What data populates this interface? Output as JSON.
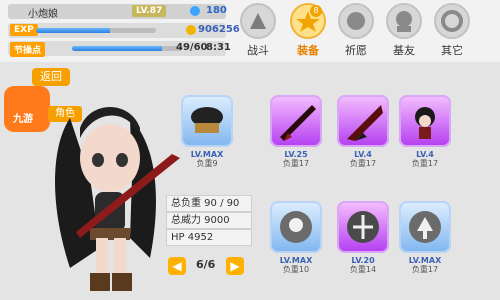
{
  "player": {
    "name": "小炮娘",
    "level": "LV.87",
    "gems": "180",
    "exp_label": "EXP",
    "gold": "906256",
    "stamina_label": "节操点",
    "stamina": "49/60",
    "timer": "8:31",
    "exp_progress": 0.62,
    "stamina_progress": 0.82
  },
  "tabs": [
    {
      "label": "战斗",
      "active": false
    },
    {
      "label": "装备",
      "active": true,
      "badge": "8"
    },
    {
      "label": "祈愿",
      "active": false
    },
    {
      "label": "基友",
      "active": false
    },
    {
      "label": "其它",
      "active": false
    }
  ],
  "back_label": "返回",
  "watermark_text": "九游",
  "watermark_small": "角色",
  "top_slots": [
    {
      "level": "LV.MAX",
      "weight": "负重9",
      "style": "blue"
    },
    {
      "level": "LV.25",
      "weight": "负重17",
      "style": "purple"
    },
    {
      "level": "LV.4",
      "weight": "负重17",
      "style": "purple"
    },
    {
      "level": "LV.4",
      "weight": "负重17",
      "style": "purple"
    }
  ],
  "bottom_slots": [
    {
      "level": "LV.MAX",
      "weight": "负重10",
      "style": "blue"
    },
    {
      "level": "LV.20",
      "weight": "负重14",
      "style": "purple"
    },
    {
      "level": "LV.MAX",
      "weight": "负重17",
      "style": "blue"
    }
  ],
  "stats": {
    "load": "总负重 90 / 90",
    "power": "总威力 9000",
    "hp": "HP 4952"
  },
  "pager": {
    "current": "6/6"
  }
}
